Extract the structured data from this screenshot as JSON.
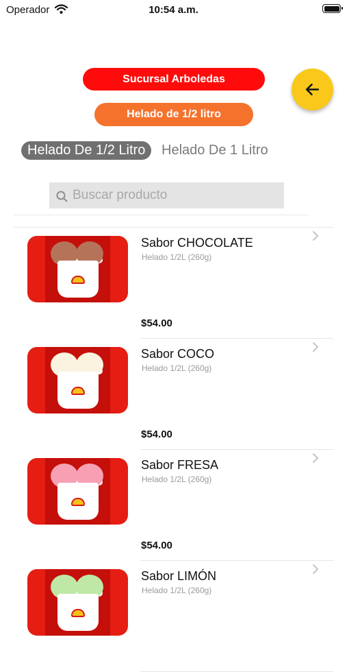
{
  "status_bar": {
    "carrier": "Operador",
    "time": "10:54 a.m."
  },
  "header": {
    "branch_label": "Sucursal Arboledas",
    "size_label": "Helado de 1/2 litro",
    "back_icon": "arrow-left-icon"
  },
  "segments": [
    {
      "label": "Helado De 1/2 Litro",
      "selected": true
    },
    {
      "label": "Helado De 1 Litro",
      "selected": false
    }
  ],
  "search": {
    "placeholder": "Buscar producto",
    "value": ""
  },
  "products": [
    {
      "name": "Sabor CHOCOLATE",
      "subtitle": "Helado 1/2L (260g)",
      "price": "$54.00",
      "scoop_color": "#b5735a"
    },
    {
      "name": "Sabor COCO",
      "subtitle": "Helado 1/2L (260g)",
      "price": "$54.00",
      "scoop_color": "#fbf3e0"
    },
    {
      "name": "Sabor FRESA",
      "subtitle": "Helado 1/2L (260g)",
      "price": "$54.00",
      "scoop_color": "#f7a0b4"
    },
    {
      "name": "Sabor LIMÓN",
      "subtitle": "Helado 1/2L (260g)",
      "price": "",
      "scoop_color": "#bfe8a6"
    }
  ],
  "colors": {
    "branch_pill": "#ff0b0b",
    "size_pill": "#f5722d",
    "back_button": "#f9c81a",
    "segment_active": "#707070",
    "thumb_background": "#e51d12"
  }
}
